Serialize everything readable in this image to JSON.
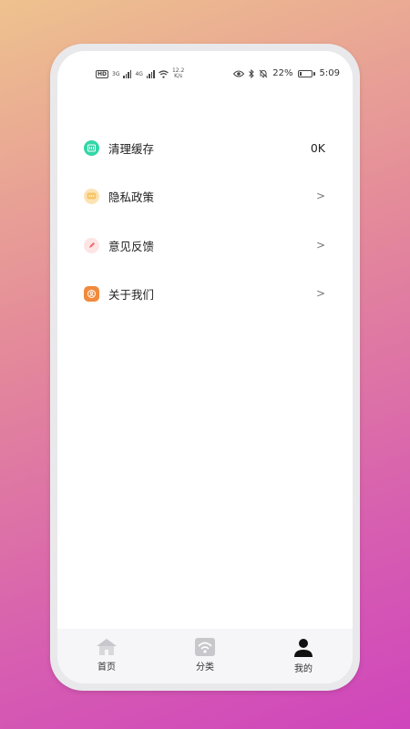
{
  "status_bar": {
    "hd": "HD",
    "net1": "3G",
    "net2": "4G",
    "speed_value": "12.2",
    "speed_unit": "K/s",
    "battery": "22%",
    "time": "5:09"
  },
  "menu": [
    {
      "label": "清理缓存",
      "value": "0K",
      "icon": "storage-icon",
      "color": "#34d6a8"
    },
    {
      "label": "隐私政策",
      "value": ">",
      "icon": "privacy-icon",
      "color": "#f6c56a"
    },
    {
      "label": "意见反馈",
      "value": ">",
      "icon": "feedback-icon",
      "color": "#f06a6a"
    },
    {
      "label": "关于我们",
      "value": ">",
      "icon": "about-icon",
      "color": "#f18a3c"
    }
  ],
  "tabs": [
    {
      "label": "首页",
      "icon": "home-icon"
    },
    {
      "label": "分类",
      "icon": "category-icon"
    },
    {
      "label": "我的",
      "icon": "profile-icon",
      "active": true
    }
  ],
  "colors": {
    "tab_inactive": "#c8c8cc",
    "tab_active": "#111111"
  }
}
